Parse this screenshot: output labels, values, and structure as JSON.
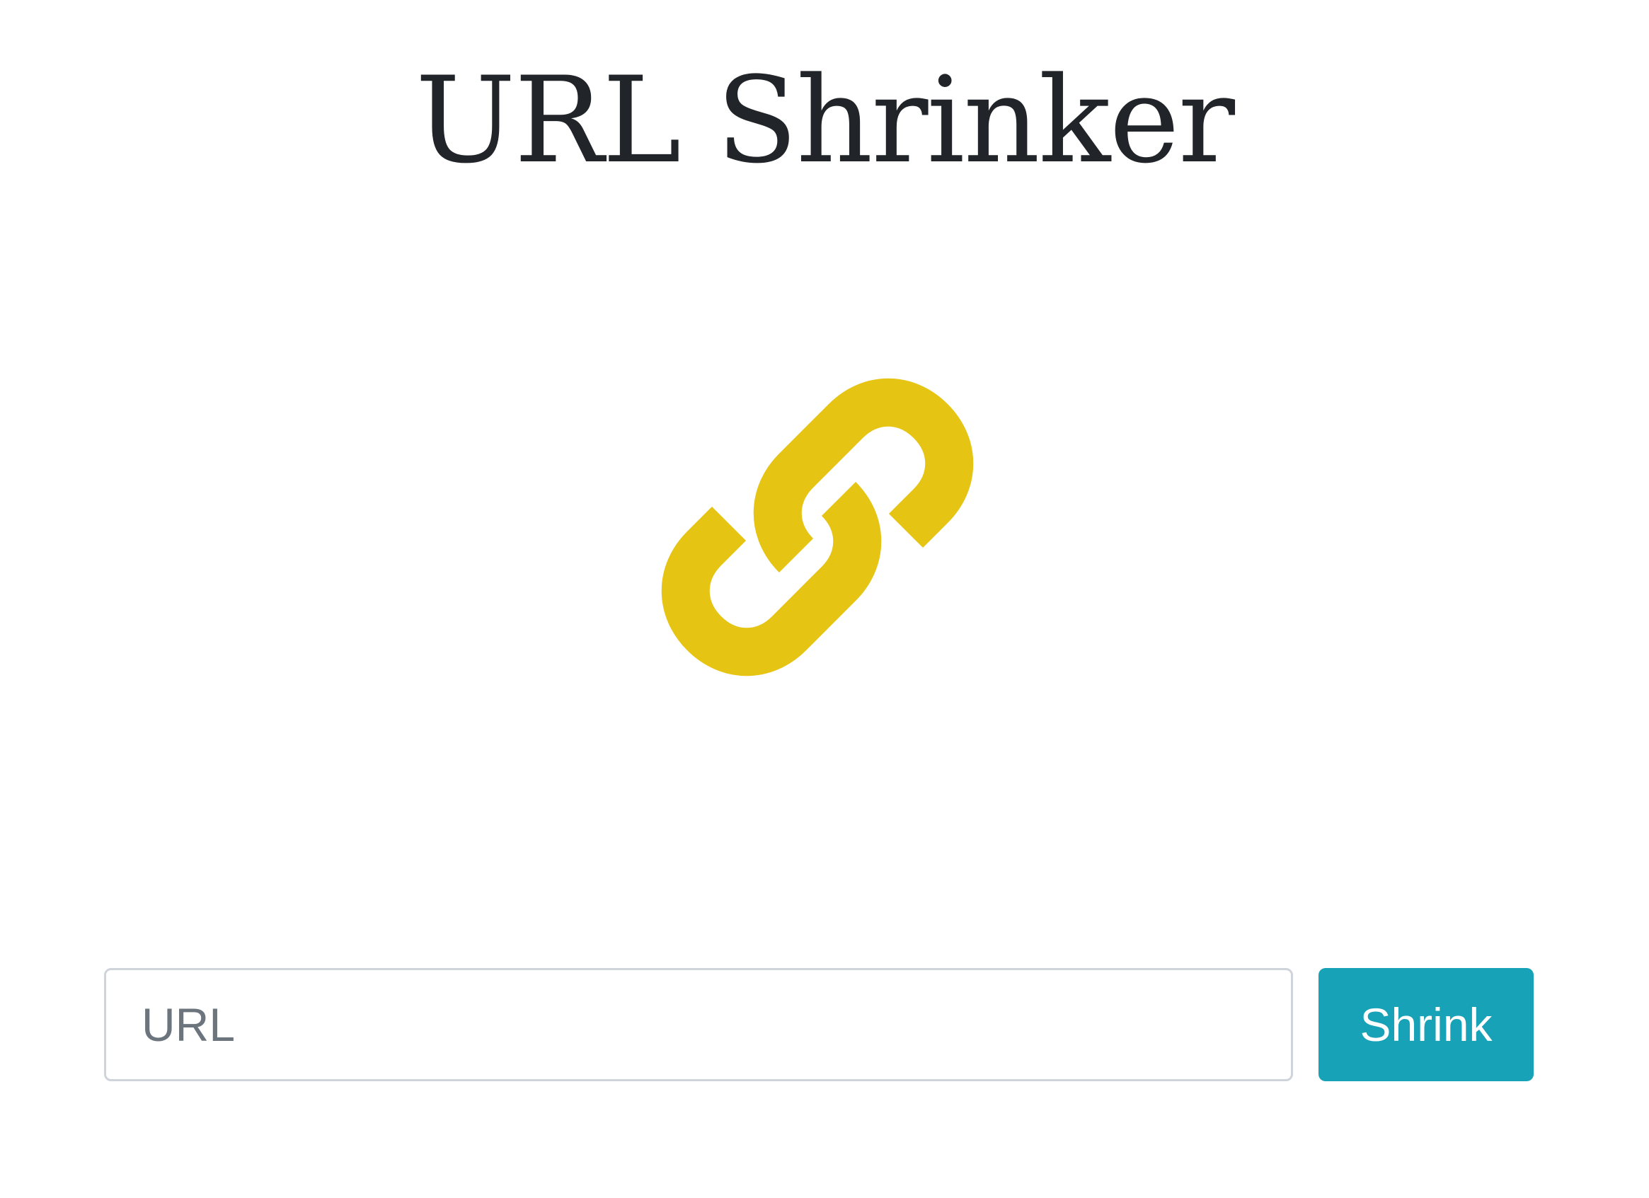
{
  "page": {
    "title": "URL Shrinker"
  },
  "logo": {
    "icon": "link-icon",
    "color": "#e6c414"
  },
  "form": {
    "url_placeholder": "URL",
    "url_value": "",
    "submit_label": "Shrink",
    "submit_color": "#17a2b8"
  }
}
